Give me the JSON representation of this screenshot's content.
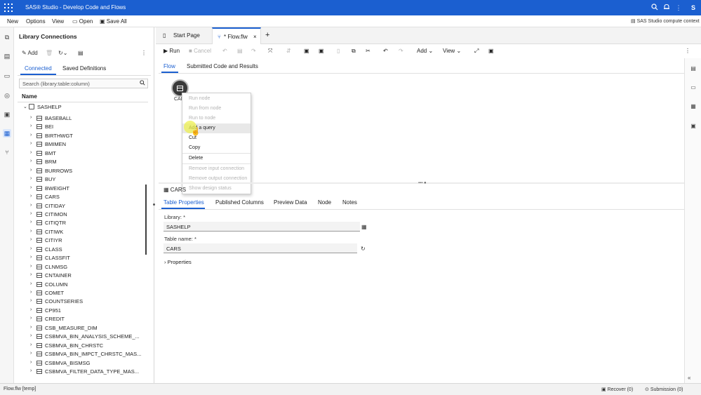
{
  "app": {
    "title": "SAS® Studio - Develop Code and Flows",
    "user_initial": "S",
    "compute_context": "SAS Studio compute context",
    "colors": {
      "brand": "#1b5fd0",
      "highlight": "#eef050"
    }
  },
  "menubar": {
    "items": [
      "New",
      "Options",
      "View"
    ],
    "open": "Open",
    "save_all": "Save All"
  },
  "library": {
    "title": "Library Connections",
    "add": "Add",
    "tabs": [
      "Connected",
      "Saved Definitions"
    ],
    "search_placeholder": "Search (library:table:column)",
    "column_header": "Name",
    "library_name": "SASHELP",
    "tables": [
      "BASEBALL",
      "BEI",
      "BIRTHWGT",
      "BMIMEN",
      "BMT",
      "BRM",
      "BURROWS",
      "BUY",
      "BWEIGHT",
      "CARS",
      "CITIDAY",
      "CITIMON",
      "CITIQTR",
      "CITIWK",
      "CITIYR",
      "CLASS",
      "CLASSFIT",
      "CLNMSG",
      "CNTAINER",
      "COLUMN",
      "COMET",
      "COUNTSERIES",
      "CP951",
      "CREDIT",
      "CSB_MEASURE_DIM",
      "CSBMVA_BIN_ANALYSIS_SCHEME_...",
      "CSBMVA_BIN_CHRSTC",
      "CSBMVA_BIN_IMPCT_CHRSTC_MAS...",
      "CSBMVA_BISMSG",
      "CSBMVA_FILTER_DATA_TYPE_MAS..."
    ]
  },
  "editor": {
    "tabs": [
      "Start Page",
      "* Flow.flw"
    ],
    "toolbar": {
      "run": "Run",
      "cancel": "Cancel",
      "add": "Add",
      "view": "View"
    },
    "subtabs": [
      "Flow",
      "Submitted Code and Results"
    ]
  },
  "flow": {
    "node_label": "CARS",
    "context_menu": [
      {
        "label": "Run node",
        "enabled": false
      },
      {
        "label": "Run from node",
        "enabled": false
      },
      {
        "label": "Run to node",
        "enabled": false
      },
      {
        "label": "Add a query",
        "enabled": true,
        "hovered": true
      },
      {
        "label": "Cut",
        "enabled": true
      },
      {
        "label": "Copy",
        "enabled": true
      },
      {
        "label": "Delete",
        "enabled": true
      },
      {
        "label": "Remove input connection",
        "enabled": false
      },
      {
        "label": "Remove output connection",
        "enabled": false
      },
      {
        "label": "Show design status",
        "enabled": false
      }
    ]
  },
  "properties": {
    "title": "CARS",
    "tabs": [
      "Table Properties",
      "Published Columns",
      "Preview Data",
      "Node",
      "Notes"
    ],
    "library_label": "Library: *",
    "library_value": "SASHELP",
    "table_label": "Table name: *",
    "table_value": "CARS",
    "properties_toggle": "Properties"
  },
  "status": {
    "file": "Flow.flw [temp]",
    "recover": "Recover (0)",
    "submission": "Submission (0)"
  }
}
